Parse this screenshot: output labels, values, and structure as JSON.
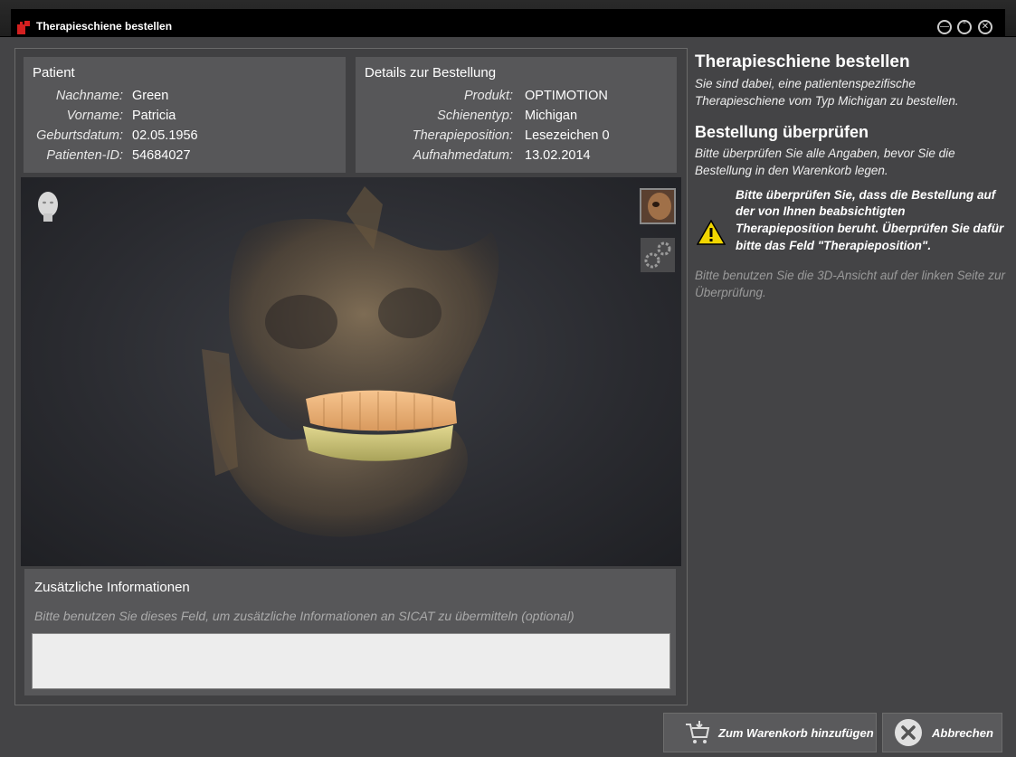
{
  "window": {
    "title": "Therapieschiene bestellen"
  },
  "patient": {
    "heading": "Patient",
    "fields": [
      {
        "label": "Nachname:",
        "value": "Green"
      },
      {
        "label": "Vorname:",
        "value": "Patricia"
      },
      {
        "label": "Geburtsdatum:",
        "value": "02.05.1956"
      },
      {
        "label": "Patienten-ID:",
        "value": "54684027"
      }
    ]
  },
  "order_details": {
    "heading": "Details zur Bestellung",
    "fields": [
      {
        "label": "Produkt:",
        "value": "OPTIMOTION"
      },
      {
        "label": "Schienentyp:",
        "value": "Michigan"
      },
      {
        "label": "Therapieposition:",
        "value": "Lesezeichen 0"
      },
      {
        "label": "Aufnahmedatum:",
        "value": "13.02.2014"
      }
    ]
  },
  "viewer": {
    "icons": [
      "head-orientation-icon",
      "volume-rendering-icon",
      "settings-gears-icon"
    ]
  },
  "additional_info": {
    "heading": "Zusätzliche Informationen",
    "hint": "Bitte benutzen Sie dieses Feld, um zusätzliche Informationen an SICAT zu übermitteln (optional)",
    "value": ""
  },
  "instructions": {
    "title": "Therapieschiene bestellen",
    "intro": "Sie sind dabei, eine patientenspezifische Therapieschiene vom Typ Michigan zu bestellen.",
    "subtitle": "Bestellung überprüfen",
    "check_text": "Bitte überprüfen Sie alle Angaben, bevor Sie die Bestellung in den Warenkorb legen.",
    "warning": "Bitte überprüfen Sie, dass die Bestellung auf der von Ihnen beabsichtigten Therapieposition beruht. Überprüfen Sie dafür bitte das Feld \"Therapieposition\".",
    "hint_3d": "Bitte benutzen Sie die 3D-Ansicht auf der linken Seite zur Überprüfung."
  },
  "buttons": {
    "add_to_cart": "Zum Warenkorb hinzufügen",
    "cancel": "Abbrechen"
  },
  "colors": {
    "accent_red": "#d42020",
    "warning_yellow": "#f2d600",
    "background": "#444446"
  }
}
